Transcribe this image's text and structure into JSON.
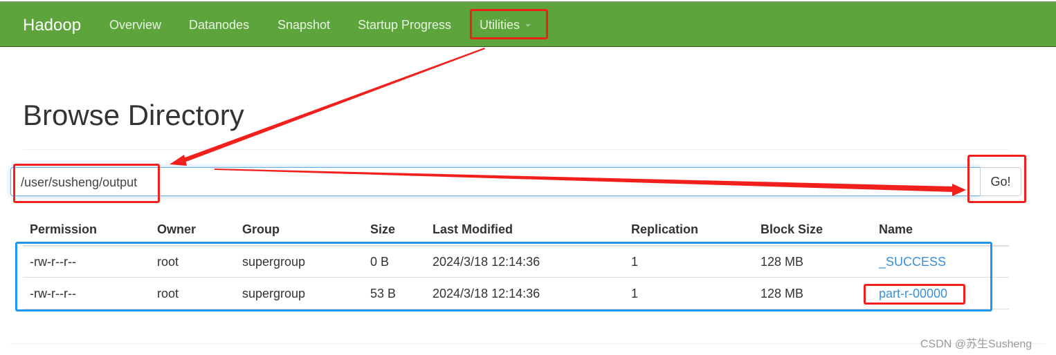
{
  "navbar": {
    "brand": "Hadoop",
    "items": [
      {
        "label": "Overview"
      },
      {
        "label": "Datanodes"
      },
      {
        "label": "Snapshot"
      },
      {
        "label": "Startup Progress"
      },
      {
        "label": "Utilities"
      }
    ]
  },
  "page_title": "Browse Directory",
  "path_input": {
    "value": "/user/susheng/output"
  },
  "go_label": "Go!",
  "table": {
    "headers": [
      "Permission",
      "Owner",
      "Group",
      "Size",
      "Last Modified",
      "Replication",
      "Block Size",
      "Name"
    ],
    "rows": [
      [
        "-rw-r--r--",
        "root",
        "supergroup",
        "0 B",
        "2024/3/18 12:14:36",
        "1",
        "128 MB",
        "_SUCCESS"
      ],
      [
        "-rw-r--r--",
        "root",
        "supergroup",
        "53 B",
        "2024/3/18 12:14:36",
        "1",
        "128 MB",
        "part-r-00000"
      ]
    ]
  },
  "watermark": "CSDN @苏生Susheng",
  "colors": {
    "navbar": "#5ea43d",
    "annotation_red": "#f2201c",
    "annotation_blue": "#1e97f3",
    "link": "#3a8fd8"
  }
}
